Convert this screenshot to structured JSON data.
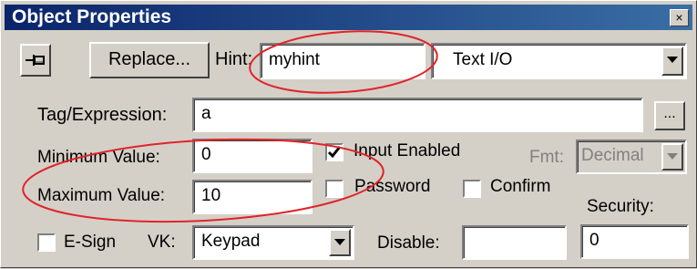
{
  "window": {
    "title": "Object Properties",
    "close_glyph": "×"
  },
  "toolbar": {
    "pin_icon": "pin-icon",
    "replace_label": "Replace...",
    "hint_label": "Hint:",
    "hint_value": "myhint",
    "type_value": "Text I/O"
  },
  "tag": {
    "label": "Tag/Expression:",
    "value": "a",
    "browse_label": "..."
  },
  "minimum": {
    "label": "Minimum Value:",
    "value": "0"
  },
  "maximum": {
    "label": "Maximum Value:",
    "value": "10"
  },
  "options": {
    "input_enabled_label": "Input Enabled",
    "input_enabled_checked": true,
    "password_label": "Password",
    "password_checked": false,
    "confirm_label": "Confirm",
    "confirm_checked": false
  },
  "fmt": {
    "label": "Fmt:",
    "value": "Decimal"
  },
  "security": {
    "label": "Security:",
    "value": "0"
  },
  "esign": {
    "label": "E-Sign",
    "checked": false
  },
  "vk": {
    "label": "VK:",
    "value": "Keypad"
  },
  "disable": {
    "label": "Disable:",
    "value": ""
  },
  "annotation_color": "#e0242a"
}
